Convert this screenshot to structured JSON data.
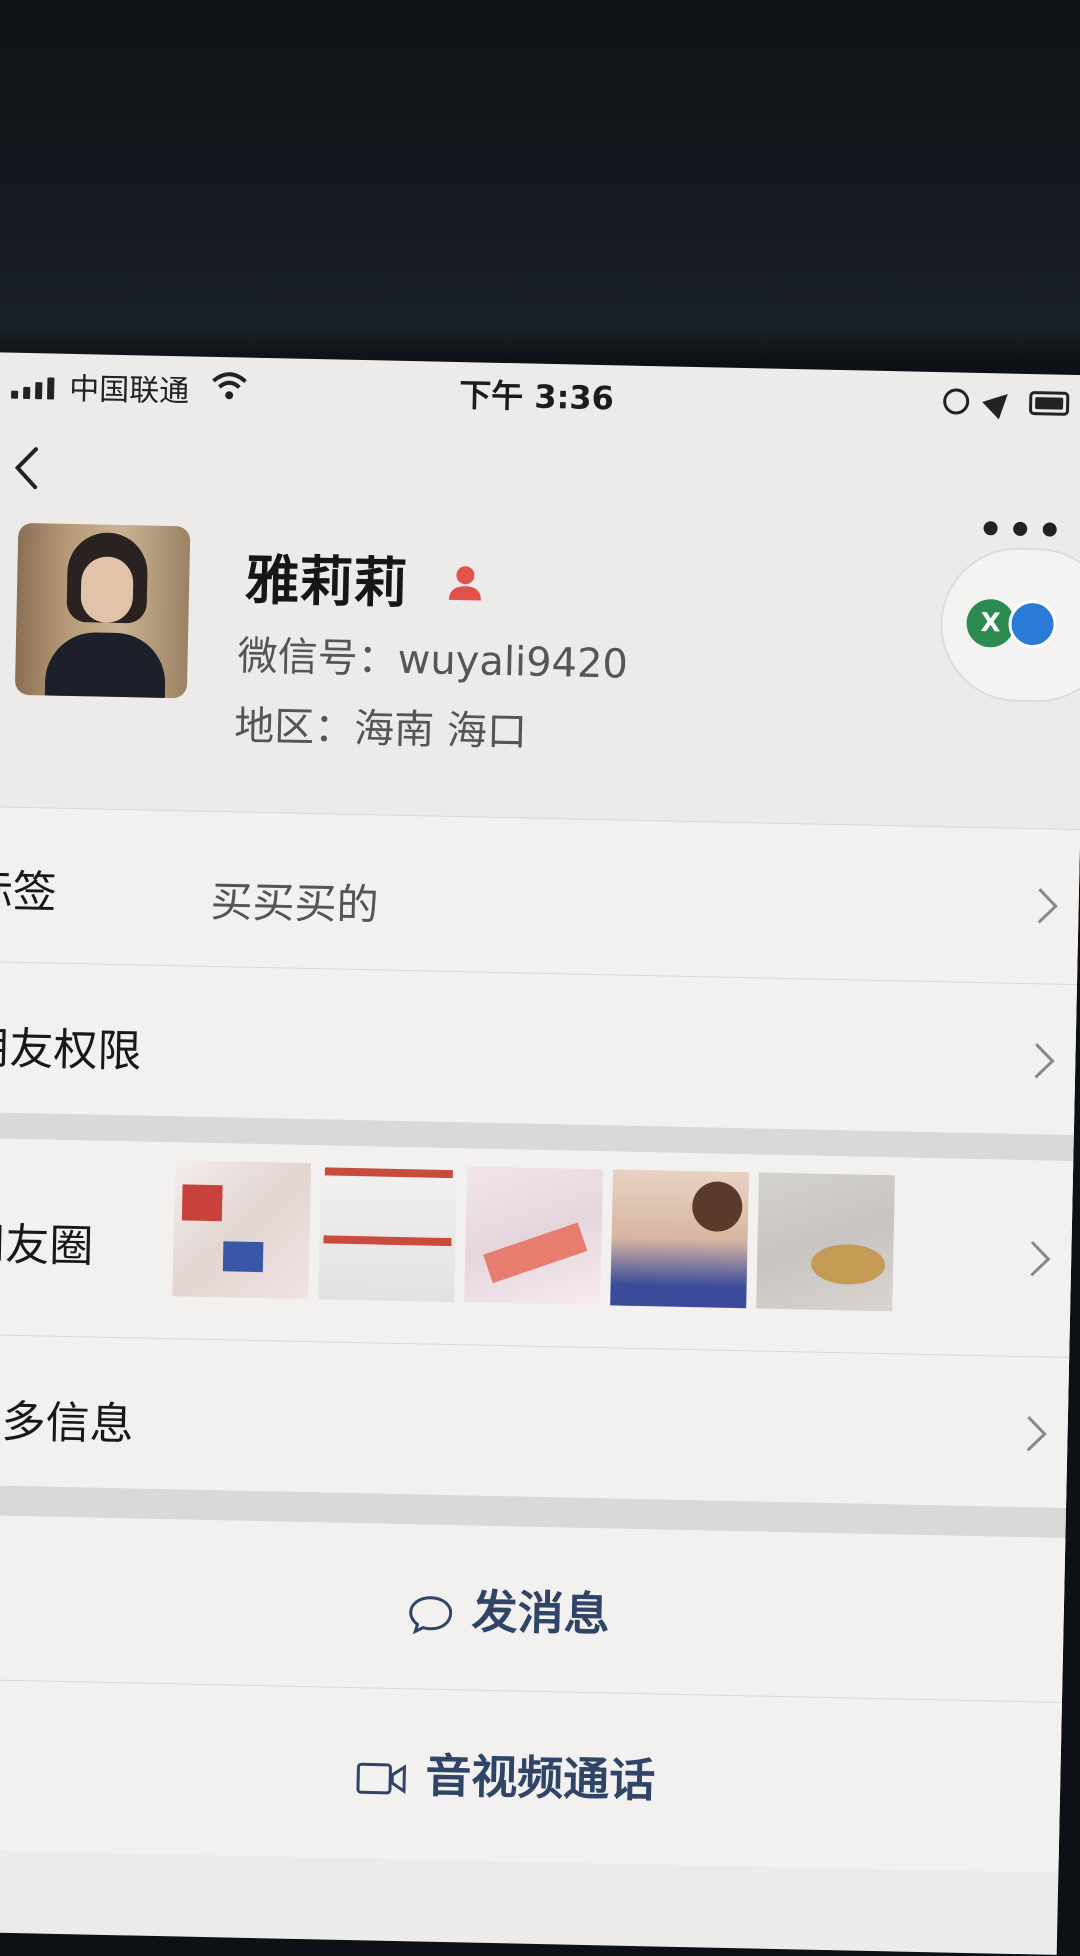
{
  "status_bar": {
    "carrier": "中国联通",
    "time": "下午 3:36"
  },
  "profile": {
    "name": "雅莉莉",
    "wechat_id": "微信号：wuyali9420",
    "region": "地区：海南 海口",
    "badge": "X"
  },
  "rows": {
    "tags": {
      "label": "标签",
      "value": "买买买的"
    },
    "friend_permissions": {
      "label": "朋友权限"
    },
    "moments": {
      "label": "朋友圈"
    },
    "more_info": {
      "label": "更多信息"
    }
  },
  "actions": {
    "send_message": "发消息",
    "video_call": "音视频通话"
  },
  "icons": [
    "back-icon",
    "more-icon",
    "person-icon",
    "chat-bubble-icon",
    "video-camera-icon",
    "chevron-right-icon"
  ],
  "colors": {
    "action_text": "#2f4466",
    "person_icon": "#e0524a",
    "background": "#ecebea"
  }
}
